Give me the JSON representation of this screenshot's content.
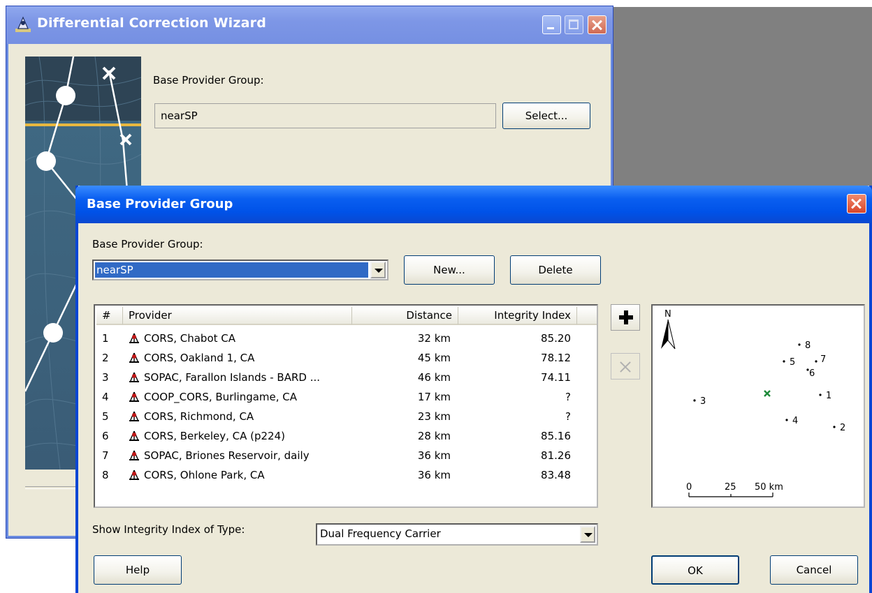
{
  "wizard": {
    "title": "Differential Correction Wizard",
    "base_provider_group_label": "Base Provider Group:",
    "selected_group": "nearSP",
    "select_button": "Select..."
  },
  "dialog": {
    "title": "Base Provider Group",
    "group_label": "Base Provider Group:",
    "group_selected": "nearSP",
    "new_button": "New...",
    "delete_button": "Delete",
    "columns": {
      "num": "#",
      "provider": "Provider",
      "distance": "Distance",
      "integrity": "Integrity Index"
    },
    "rows": [
      {
        "num": "1",
        "provider": "CORS, Chabot CA",
        "distance": "32 km",
        "integrity": "85.20"
      },
      {
        "num": "2",
        "provider": "CORS, Oakland 1, CA",
        "distance": "45 km",
        "integrity": "78.12"
      },
      {
        "num": "3",
        "provider": "SOPAC, Farallon Islands - BARD ...",
        "distance": "46 km",
        "integrity": "74.11"
      },
      {
        "num": "4",
        "provider": "COOP_CORS, Burlingame, CA",
        "distance": "17 km",
        "integrity": "?"
      },
      {
        "num": "5",
        "provider": "CORS, Richmond, CA",
        "distance": "23 km",
        "integrity": "?"
      },
      {
        "num": "6",
        "provider": "CORS, Berkeley, CA (p224)",
        "distance": "28 km",
        "integrity": "85.16"
      },
      {
        "num": "7",
        "provider": "SOPAC, Briones Reservoir, daily",
        "distance": "36 km",
        "integrity": "81.26"
      },
      {
        "num": "8",
        "provider": "CORS, Ohlone Park, CA",
        "distance": "36 km",
        "integrity": "83.48"
      }
    ],
    "map": {
      "north_label": "N",
      "scale_labels": [
        "0",
        "25",
        "50 km"
      ],
      "point_labels": [
        "1",
        "2",
        "3",
        "4",
        "5",
        "6",
        "7",
        "8"
      ],
      "rover_color": "#1e8a3a"
    },
    "integrity_type_label": "Show Integrity Index of Type:",
    "integrity_type_value": "Dual Frequency Carrier",
    "help_button": "Help",
    "ok_button": "OK",
    "cancel_button": "Cancel"
  },
  "colors": {
    "dialog_title": "#0052e8",
    "wizard_title_inactive": "#7d96e6",
    "selection": "#316ac5",
    "face": "#ece9d8"
  }
}
